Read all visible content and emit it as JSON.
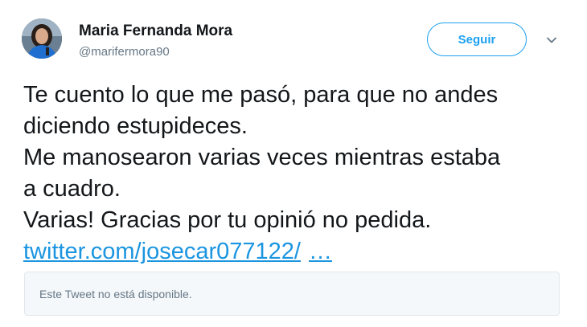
{
  "user": {
    "display_name": "Maria Fernanda Mora",
    "handle": "@marifermora90"
  },
  "actions": {
    "follow_label": "Seguir",
    "more_icon": "chevron-down-icon"
  },
  "tweet": {
    "lines": [
      "Te cuento lo que me pasó, para que no andes",
      "diciendo estupideces.",
      "Me manosearon varias veces mientras estaba",
      "a cuadro.",
      "Varias! Gracias por tu opinió no pedida."
    ],
    "link_text": "twitter.com/josecar077122/",
    "link_ellipsis": "…"
  },
  "quoted_tweet": {
    "unavailable_text": "Este Tweet no está disponible."
  },
  "colors": {
    "accent": "#1da1f2",
    "link": "#1b95e0",
    "secondary_text": "#657786",
    "quote_bg": "#f5f8fa",
    "quote_border": "#e1e8ed"
  }
}
